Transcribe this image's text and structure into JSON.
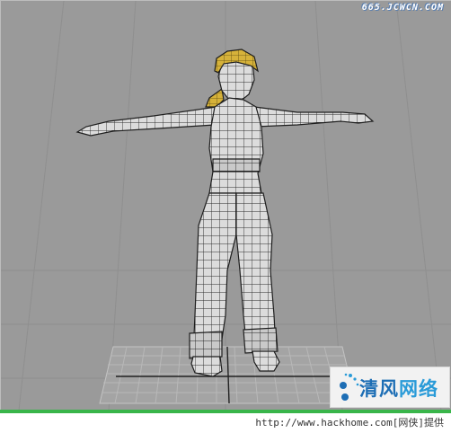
{
  "viewport": {
    "background_color": "#9a9a9a",
    "grid_color": "#8f8f8f",
    "floor_grid_color": "#b8b8b8",
    "model_color": "#dcdcdc",
    "wire_color": "#2b2b2b",
    "hair_color": "#d6b23a"
  },
  "watermark_top": "665.JCWCN.COM",
  "logo": {
    "part1": "清风",
    "part2": "网络",
    "icon": "logo-dots-icon"
  },
  "footer": {
    "text": "http://www.hackhome.com[网侠]提供",
    "accent_color": "#39b54a"
  }
}
